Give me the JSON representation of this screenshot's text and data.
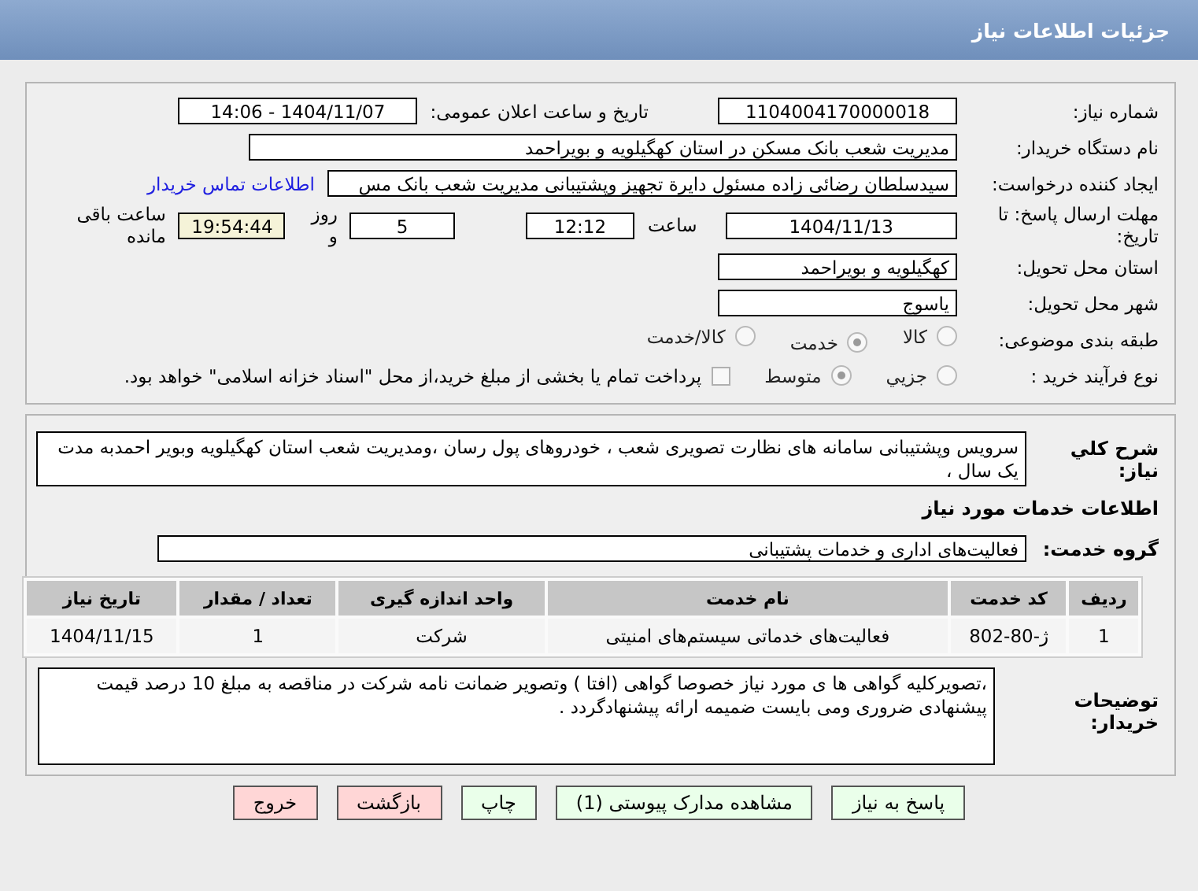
{
  "header": {
    "title": "جزئیات اطلاعات نیاز"
  },
  "need_number": {
    "label": "شماره نیاز:",
    "value": "1104004170000018"
  },
  "announce": {
    "label": "تاریخ و ساعت اعلان عمومی:",
    "value": "1404/11/07 - 14:06"
  },
  "buyer_org": {
    "label": "نام دستگاه خریدار:",
    "value": "مدیریت شعب بانک مسکن در استان کهگیلویه و بویراحمد"
  },
  "requester": {
    "label": "ایجاد کننده درخواست:",
    "value": "سیدسلطان رضائی زاده مسئول دایرة تجهیز وپشتیبانی  مدیریت شعب بانک مس",
    "link": "اطلاعات تماس خریدار"
  },
  "deadline": {
    "label": "مهلت ارسال پاسخ: تا تاریخ:",
    "date": "1404/11/13",
    "time_label": "ساعت",
    "time": "12:12",
    "days": "5",
    "days_label": "روز و",
    "remaining": "19:54:44",
    "remaining_label": "ساعت باقی مانده"
  },
  "province": {
    "label": "استان محل تحویل:",
    "value": "کهگیلویه و بویراحمد"
  },
  "city": {
    "label": "شهر محل تحویل:",
    "value": "یاسوج"
  },
  "category": {
    "label": "طبقه بندی موضوعی:",
    "options": [
      {
        "label": "کالا",
        "selected": false
      },
      {
        "label": "خدمت",
        "selected": true
      },
      {
        "label": "کالا/خدمت",
        "selected": false
      }
    ]
  },
  "process": {
    "label": "نوع فرآیند خرید :",
    "options": [
      {
        "label": "جزیي",
        "selected": false
      },
      {
        "label": "متوسط",
        "selected": true
      }
    ],
    "treasury": {
      "label": "پرداخت تمام یا بخشی از مبلغ خرید،از محل \"اسناد خزانه اسلامی\" خواهد بود.",
      "checked": false
    }
  },
  "description": {
    "label": "شرح کلي نیاز:",
    "value": "سرویس وپشتیبانی سامانه های نظارت تصویری شعب ، خودروهای پول رسان ،ومدیریت شعب استان کهگیلویه وبویر احمدبه مدت یک سال ،"
  },
  "services_heading": "اطلاعات خدمات مورد نیاز",
  "service_group": {
    "label": "گروه خدمت:",
    "value": "فعالیت‌های اداری و خدمات پشتیبانی"
  },
  "table": {
    "columns": [
      "ردیف",
      "کد خدمت",
      "نام خدمت",
      "واحد اندازه گیری",
      "تعداد / مقدار",
      "تاریخ نیاز"
    ],
    "rows": [
      [
        "1",
        "ژ-80-802",
        "فعالیت‌های خدماتی سیستم‌های امنیتی",
        "شرکت",
        "1",
        "1404/11/15"
      ]
    ]
  },
  "buyer_notes": {
    "label": "توضیحات خریدار:",
    "value": "،تصویرکلیه گواهی ها ی مورد نیاز خصوصا گواهی (افتا ) وتصویر ضمانت نامه شرکت در مناقصه به مبلغ 10 درصد قیمت پیشنهادی ضروری ومی بایست ضمیمه ارائه پیشنهادگردد ."
  },
  "buttons": [
    {
      "label": "پاسخ به نیاز",
      "kind": "action"
    },
    {
      "label": "مشاهده مدارک پیوستی (1)",
      "kind": "action"
    },
    {
      "label": "چاپ",
      "kind": "action"
    },
    {
      "label": "بازگشت",
      "kind": "exit"
    },
    {
      "label": "خروج",
      "kind": "exit"
    }
  ]
}
